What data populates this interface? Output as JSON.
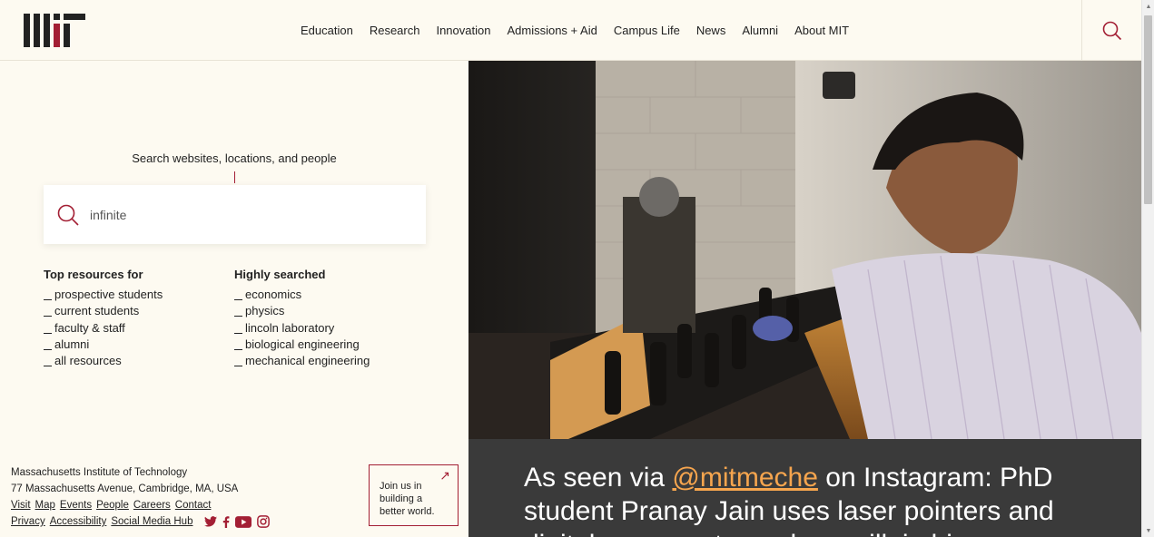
{
  "header": {
    "logo_alt": "MIT",
    "nav": [
      "Education",
      "Research",
      "Innovation",
      "Admissions + Aid",
      "Campus Life",
      "News",
      "Alumni",
      "About MIT"
    ]
  },
  "search": {
    "title": "Search websites, locations, and people",
    "value": "infinite",
    "icon": "search-icon"
  },
  "top_resources": {
    "heading": "Top resources for",
    "items": [
      "prospective students",
      "current students",
      "faculty & staff",
      "alumni",
      "all resources"
    ]
  },
  "highly_searched": {
    "heading": "Highly searched",
    "items": [
      "economics",
      "physics",
      "lincoln laboratory",
      "biological engineering",
      "mechanical engineering"
    ]
  },
  "footer": {
    "name": "Massachusetts Institute of Technology",
    "address": "77 Massachusetts Avenue, Cambridge, MA, USA",
    "links_row1": [
      "Visit",
      "Map",
      "Events",
      "People",
      "Careers",
      "Contact"
    ],
    "links_row2": [
      "Privacy",
      "Accessibility",
      "Social Media Hub"
    ],
    "social_icons": [
      "twitter-icon",
      "facebook-icon",
      "youtube-icon",
      "instagram-icon"
    ]
  },
  "join": {
    "text": "Join us in building a better world."
  },
  "hero": {
    "caption_prefix": "As seen via ",
    "caption_handle": "@mitmeche",
    "caption_suffix": " on Instagram: PhD student Pranay Jain uses laser pointers and digital cameras to analyze milk in his"
  },
  "colors": {
    "accent": "#a31f34",
    "background": "#fdfaf1",
    "caption_bg": "#3a3a3a",
    "handle": "#f6a54e"
  }
}
